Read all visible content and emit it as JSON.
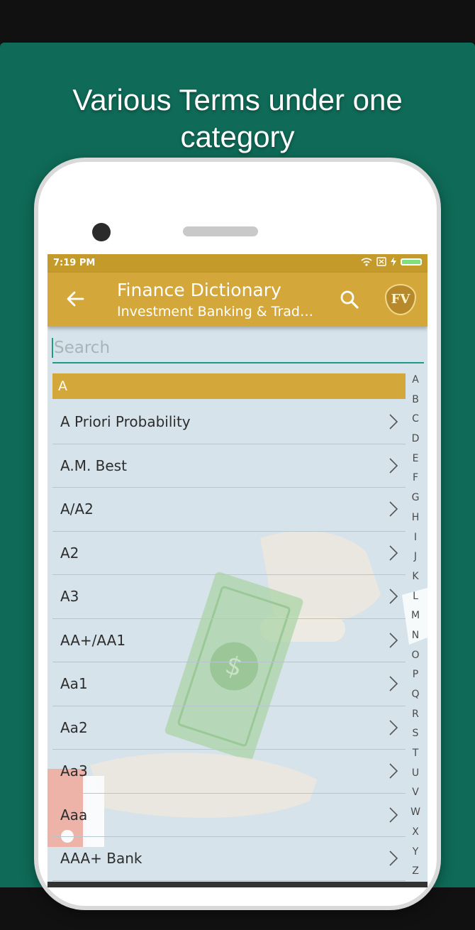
{
  "headline": "Various Terms under one category",
  "status": {
    "time": "7:19 PM"
  },
  "appbar": {
    "title": "Finance Dictionary",
    "subtitle": "Investment Banking & Trad…",
    "logo_text": "FV"
  },
  "search": {
    "placeholder": "Search"
  },
  "section": "A",
  "terms": [
    "A Priori Probability",
    "A.M. Best",
    "A/A2",
    "A2",
    "A3",
    "AA+/AA1",
    "Aa1",
    "Aa2",
    "Aa3",
    "Aaa",
    "AAA+ Bank"
  ],
  "alphabet": [
    "A",
    "B",
    "C",
    "D",
    "E",
    "F",
    "G",
    "H",
    "I",
    "J",
    "K",
    "L",
    "M",
    "N",
    "O",
    "P",
    "Q",
    "R",
    "S",
    "T",
    "U",
    "V",
    "W",
    "X",
    "Y",
    "Z"
  ],
  "colors": {
    "panel": "#0f6a57",
    "appbar": "#d4a73a",
    "statusbar": "#c49a2a",
    "accent": "#1f9a86"
  }
}
